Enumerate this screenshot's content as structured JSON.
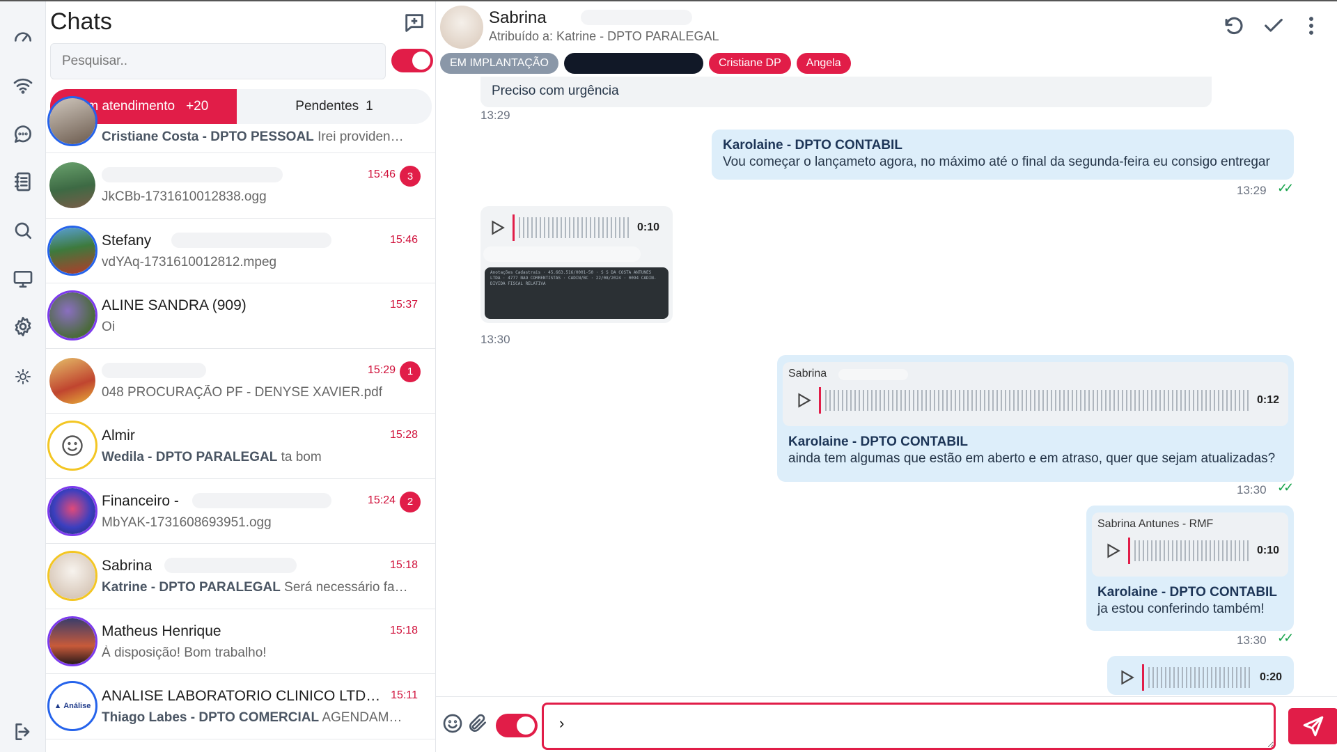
{
  "sidebar": {
    "icons": [
      "dashboard-icon",
      "wifi-icon",
      "chat-bubble-icon",
      "contacts-book-icon",
      "search-icon",
      "monitor-icon",
      "settings-gear-icon",
      "sun-theme-icon",
      "logout-icon"
    ]
  },
  "chat_list": {
    "title": "Chats",
    "search_placeholder": "Pesquisar..",
    "tabs": {
      "active_label": "Em atendimento",
      "active_count": "+20",
      "pending_label": "Pendentes",
      "pending_count": "1"
    },
    "items": [
      {
        "name": "",
        "preview_sender": "Cristiane Costa - DPTO PESSOAL",
        "preview": "Irei providenciar",
        "time": "",
        "badge": ""
      },
      {
        "name": "",
        "preview_sender": "",
        "preview": "JkCBb-1731610012838.ogg",
        "time": "15:46",
        "badge": "3"
      },
      {
        "name": "Stefany",
        "preview_sender": "",
        "preview": "vdYAq-1731610012812.mpeg",
        "time": "15:46",
        "badge": ""
      },
      {
        "name": "ALINE SANDRA (909)",
        "preview_sender": "",
        "preview": "Oi",
        "time": "15:37",
        "badge": ""
      },
      {
        "name": "",
        "preview_sender": "",
        "preview": "048 PROCURAÇÃO PF - DENYSE XAVIER.pdf",
        "time": "15:29",
        "badge": "1"
      },
      {
        "name": "Almir",
        "preview_sender": "Wedila - DPTO PARALEGAL",
        "preview": "ta bom",
        "time": "15:28",
        "badge": ""
      },
      {
        "name": "Financeiro -",
        "preview_sender": "",
        "preview": "MbYAK-1731608693951.ogg",
        "time": "15:24",
        "badge": "2"
      },
      {
        "name": "Sabrina",
        "preview_sender": "Katrine - DPTO PARALEGAL",
        "preview": "Será necessário fazer ...",
        "time": "15:18",
        "badge": ""
      },
      {
        "name": "Matheus Henrique",
        "preview_sender": "",
        "preview": "À disposição! Bom trabalho!",
        "time": "15:18",
        "badge": ""
      },
      {
        "name": "ANALISE LABORATORIO CLINICO LTDA - ...",
        "preview_sender": "Thiago Labes - DPTO COMERCIAL",
        "preview": "AGENDAMENTO ...",
        "time": "15:11",
        "badge": ""
      }
    ]
  },
  "chat": {
    "contact_name": "Sabrina",
    "assigned": "Atribuído a: Katrine - DPTO PARALEGAL",
    "tags": [
      {
        "label": "EM IMPLANTAÇÃO",
        "color": "#8a97a8"
      },
      {
        "label": "",
        "color": "#111827"
      },
      {
        "label": "Cristiane DP",
        "color": "#e11d48"
      },
      {
        "label": "Angela",
        "color": "#e11d48"
      }
    ],
    "messages": {
      "m1_text": "Preciso com urgência",
      "m1_time": "13:29",
      "m2_sender": "Karolaine - DPTO CONTABIL",
      "m2_text": "Vou começar o lançameto agora, no máximo até o final da segunda-feira eu consigo entregar",
      "m2_time": "13:29",
      "m3_audio_dur": "0:10",
      "m3_time": "13:30",
      "m3_image_text": "Anotações Cadastrais · 45.663.516/0001-50 · S S DA COSTA ANTUNES LTDA · 4777 NAO CORRENTISTAS · CADIN/BC · 22/08/2024 · 0094 CADIN-DIVIDA FISCAL RELATIVA",
      "m4_quote_sender": "Sabrina",
      "m4_quote_dur": "0:12",
      "m4_sender": "Karolaine - DPTO CONTABIL",
      "m4_text": "ainda tem algumas que estão em aberto e em atraso, quer que sejam atualizadas?",
      "m4_time": "13:30",
      "m5_quote_sender": "Sabrina Antunes - RMF",
      "m5_quote_dur": "0:10",
      "m5_sender": "Karolaine - DPTO CONTABIL",
      "m5_text": "ja estou conferindo também!",
      "m5_time": "13:30",
      "m6_audio_dur": "0:20"
    },
    "composer_value": "›"
  },
  "colors": {
    "accent": "#e11d48",
    "outgoing_bubble": "#ddeefa",
    "incoming_bubble": "#f1f3f5",
    "read_tick": "#16a34a"
  }
}
